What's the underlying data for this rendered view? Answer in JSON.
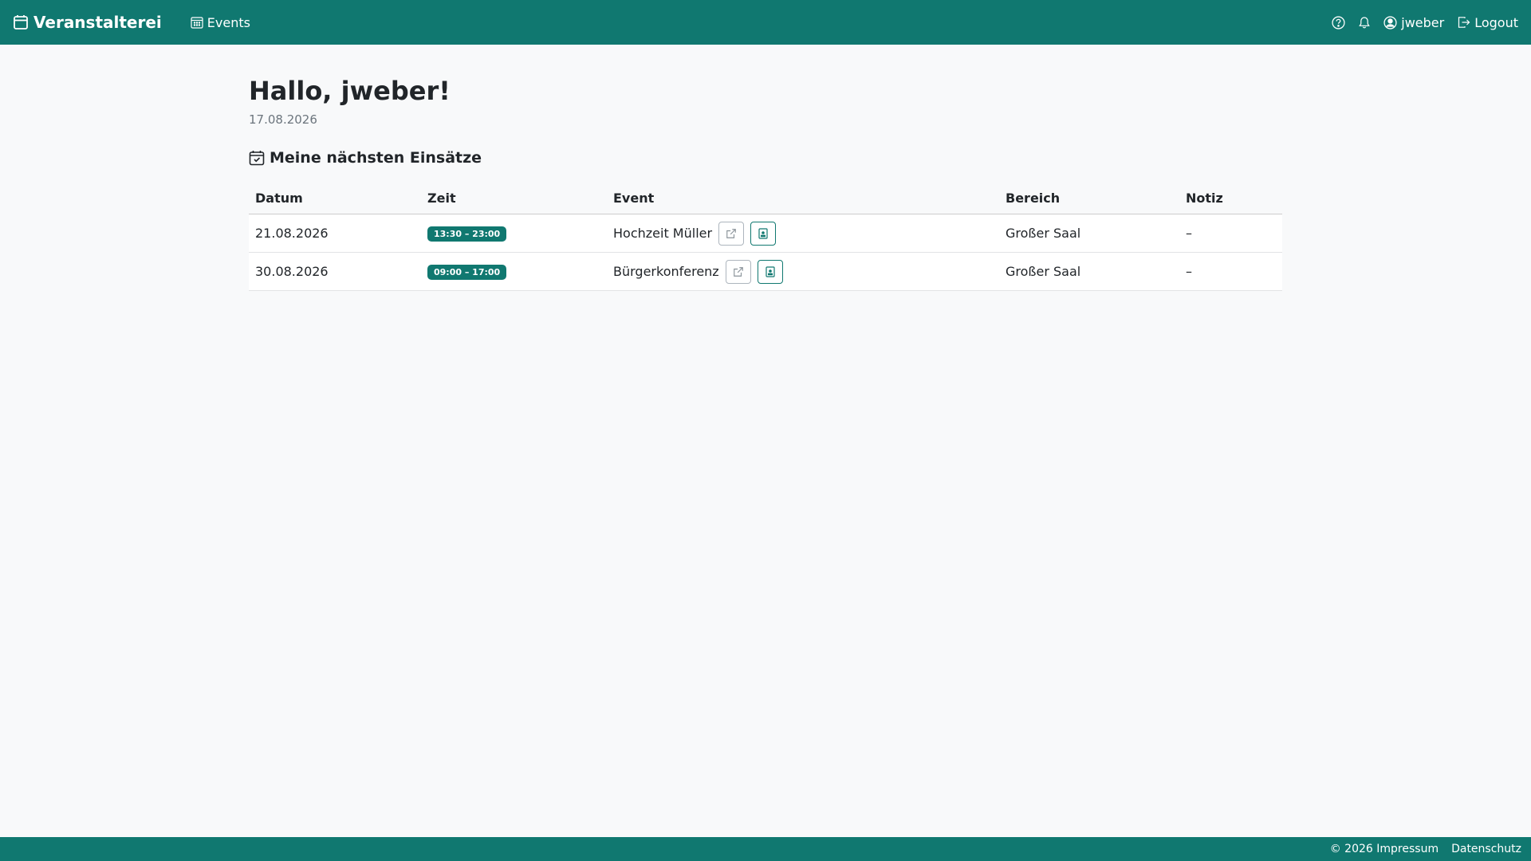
{
  "navbar": {
    "brand": "Veranstalterei",
    "events_link": "Events",
    "user": "jweber",
    "logout": "Logout"
  },
  "main": {
    "greeting": "Hallo, jweber!",
    "date": "17.08.2026",
    "section_title": "Meine nächsten Einsätze"
  },
  "table": {
    "headers": [
      "Datum",
      "Zeit",
      "Event",
      "Bereich",
      "Notiz"
    ],
    "rows": [
      {
        "datum": "21.08.2026",
        "zeit": "13:30 – 23:00",
        "event": "Hochzeit Müller",
        "bereich": "Großer Saal",
        "notiz": "–"
      },
      {
        "datum": "30.08.2026",
        "zeit": "09:00 – 17:00",
        "event": "Bürgerkonferenz",
        "bereich": "Großer Saal",
        "notiz": "–"
      }
    ]
  },
  "footer": {
    "impressum": "© 2026 Impressum",
    "datenschutz": "Datenschutz"
  },
  "colors": {
    "brand": "#107870",
    "background": "#f8f9fa"
  }
}
